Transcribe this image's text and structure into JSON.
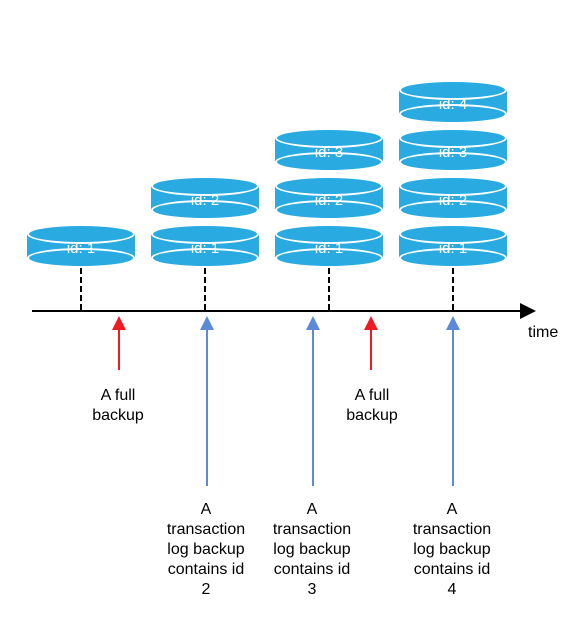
{
  "axis": {
    "label": "time"
  },
  "stacks": [
    {
      "disks": [
        {
          "label": "id: 1"
        }
      ]
    },
    {
      "disks": [
        {
          "label": "id: 1"
        },
        {
          "label": "id: 2"
        }
      ]
    },
    {
      "disks": [
        {
          "label": "id: 1"
        },
        {
          "label": "id: 2"
        },
        {
          "label": "id: 3"
        }
      ]
    },
    {
      "disks": [
        {
          "label": "id: 1"
        },
        {
          "label": "id: 2"
        },
        {
          "label": "id: 3"
        },
        {
          "label": "id: 4"
        }
      ]
    }
  ],
  "events": [
    {
      "kind": "full",
      "label": "A full\nbackup"
    },
    {
      "kind": "log",
      "label": "A\ntransaction\nlog backup\ncontains id\n2"
    },
    {
      "kind": "log",
      "label": "A\ntransaction\nlog backup\ncontains id\n3"
    },
    {
      "kind": "full",
      "label": "A full\nbackup"
    },
    {
      "kind": "log",
      "label": "A\ntransaction\nlog backup\ncontains id\n4"
    }
  ],
  "colors": {
    "disk": "#29abe2",
    "full_arrow": "#ed1c24",
    "log_arrow": "#5b8bd8",
    "axis": "#000000"
  },
  "chart_data": {
    "type": "diagram",
    "description": "Timeline of database backups. Each snapshot on the axis shows the stack of record ids present at that time. Red arrows mark full backups; blue arrows mark transaction-log backups that each contain one new id.",
    "snapshots": [
      {
        "ids_present": [
          1
        ]
      },
      {
        "ids_present": [
          1,
          2
        ]
      },
      {
        "ids_present": [
          1,
          2,
          3
        ]
      },
      {
        "ids_present": [
          1,
          2,
          3,
          4
        ]
      }
    ],
    "events_in_order": [
      {
        "type": "full_backup"
      },
      {
        "type": "transaction_log_backup",
        "contains_id": 2
      },
      {
        "type": "transaction_log_backup",
        "contains_id": 3
      },
      {
        "type": "full_backup"
      },
      {
        "type": "transaction_log_backup",
        "contains_id": 4
      }
    ]
  }
}
